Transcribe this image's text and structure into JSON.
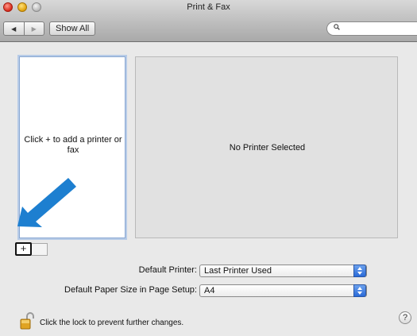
{
  "window": {
    "title": "Print & Fax"
  },
  "toolbar": {
    "back_glyph": "◀",
    "forward_glyph": "▶",
    "show_all_label": "Show All",
    "search_value": ""
  },
  "printer_list": {
    "hint": "Click + to add a printer or fax"
  },
  "detail": {
    "message": "No Printer Selected"
  },
  "buttons": {
    "add_label": "+"
  },
  "settings": {
    "default_printer_label": "Default Printer:",
    "default_printer_value": "Last Printer Used",
    "paper_size_label": "Default Paper Size in Page Setup:",
    "paper_size_value": "A4"
  },
  "footer": {
    "lock_text": "Click the lock to prevent further changes.",
    "help_label": "?"
  },
  "colors": {
    "accent_arrow": "#1d7fd0",
    "popup_blue": "#2a6ad8"
  },
  "icons": [
    "close-icon",
    "minimize-icon",
    "zoom-icon",
    "search-icon",
    "lock-icon",
    "help-icon",
    "arrow-pointer-icon"
  ]
}
